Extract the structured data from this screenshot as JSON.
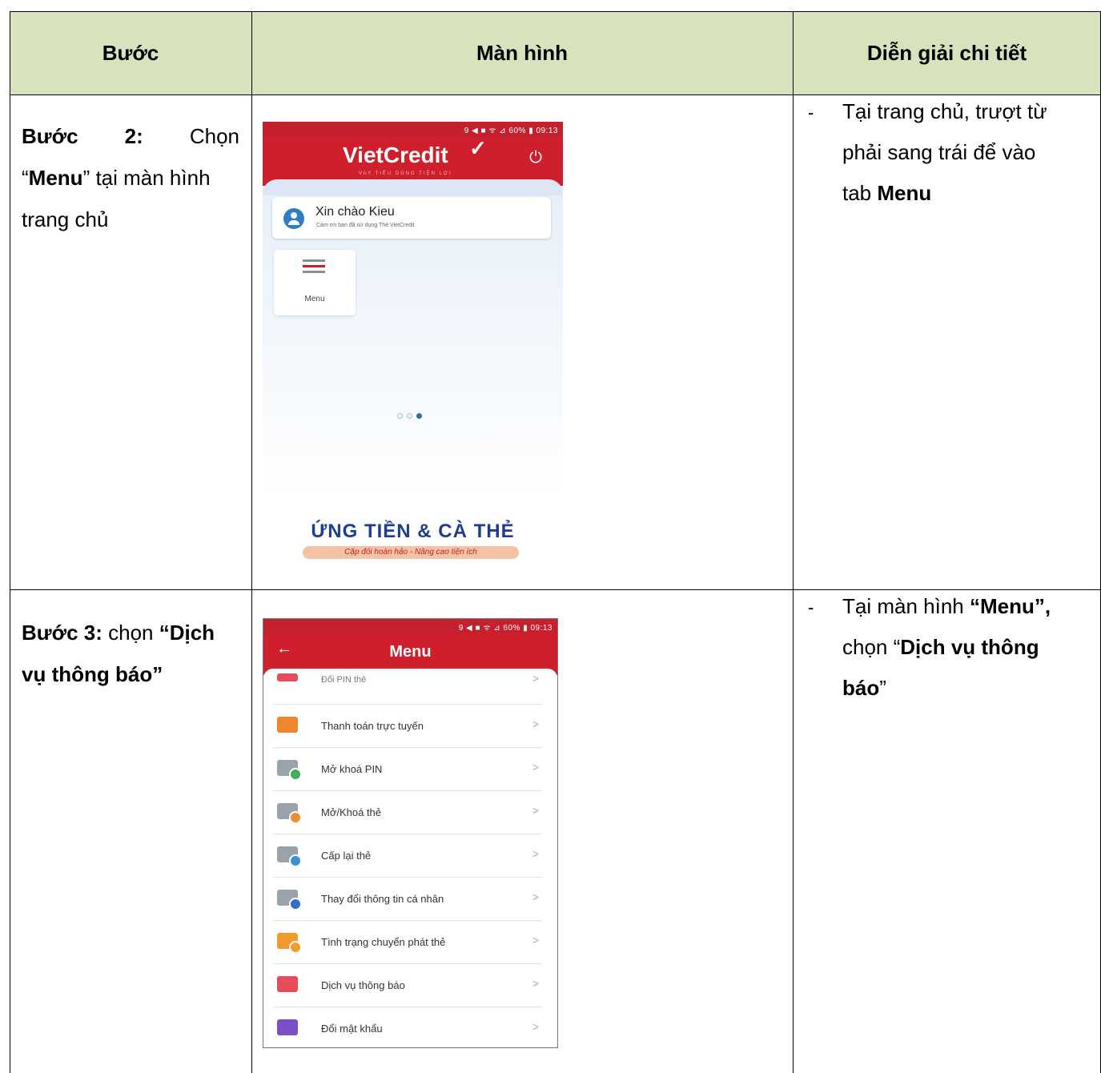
{
  "table": {
    "headers": [
      "Bước",
      "Màn hình",
      "Diễn giải chi tiết"
    ]
  },
  "step2": {
    "line1_label": "Bước",
    "line1_number": "2:",
    "line1_action": "Chọn",
    "line2_open": "“",
    "line2_bold": "Menu",
    "line2_rest": "” tại màn hình",
    "line3": "trang chủ",
    "dash": "-",
    "desc_line1": "Tại trang chủ, trượt từ",
    "desc_line2": "phải sang trái để vào",
    "desc_line3_plain": "tab ",
    "desc_line3_bold": "Menu",
    "screen": {
      "status": "9 ◀ ■ ᯤ ⊿ 60% ▮ 09:13",
      "logo": "VietCredit",
      "logo_tick": "✓",
      "logo_sub": "VAY TIÊU DÙNG TIỆN LỢI",
      "power_icon": "⏻",
      "greeting": "Xin chào Kieu",
      "greeting_sub": "Cảm ơn bạn đã sử dụng Thẻ VietCredit",
      "menu_tile": "Menu",
      "promo_title": "ỨNG TIỀN & CÀ THẺ",
      "promo_sub": "Cặp đôi hoàn hảo - Nâng cao tiện ích"
    }
  },
  "step3": {
    "line1_label": "Bước 3:",
    "line1_action": " chọn ",
    "line1_quote": "“Dịch",
    "line2": "vụ thông báo”",
    "dash": "-",
    "desc_line1_plain": "Tại màn hình ",
    "desc_line1_bold": "“Menu”,",
    "desc_line2_plain": "chọn “",
    "desc_line2_bold": "Dịch vụ thông",
    "desc_line3_bold": "báo",
    "desc_line3_plain": "”",
    "screen": {
      "status": "9 ◀ ■ ᯤ ⊿ 60% ▮ 09:13",
      "back_icon": "←",
      "title": "Menu",
      "partial_item": "Đổi PIN thẻ",
      "items": [
        {
          "label": "Thanh toán trực tuyến",
          "color": "#f0852f",
          "badge": ""
        },
        {
          "label": "Mở khoá PIN",
          "color": "#9aa3ab",
          "badge": "#3fae5a"
        },
        {
          "label": "Mở/Khoá thẻ",
          "color": "#9aa3ab",
          "badge": "#f28a2e"
        },
        {
          "label": "Cấp lại thẻ",
          "color": "#9aa3ab",
          "badge": "#3d8fd6"
        },
        {
          "label": "Thay đổi thông tin cá nhân",
          "color": "#9aa3ab",
          "badge": "#2f6fc7"
        },
        {
          "label": "Tình trạng chuyển phát thẻ",
          "color": "#f29a2e",
          "badge": "#f29a2e"
        },
        {
          "label": "Dịch vụ thông báo",
          "color": "#e84b5a",
          "badge": ""
        },
        {
          "label": "Đổi mật khẩu",
          "color": "#7b4fc8",
          "badge": ""
        }
      ],
      "chevron": ">"
    }
  }
}
